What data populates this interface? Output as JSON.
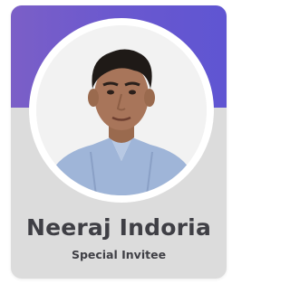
{
  "profile": {
    "name": "Neeraj Indoria",
    "role": "Special Invitee"
  },
  "colors": {
    "header_gradient_start": "#7b5fc7",
    "header_gradient_end": "#5f55d2",
    "card_background": "#dcdcdc",
    "ring": "#ffffff",
    "text": "#3f3f45"
  }
}
